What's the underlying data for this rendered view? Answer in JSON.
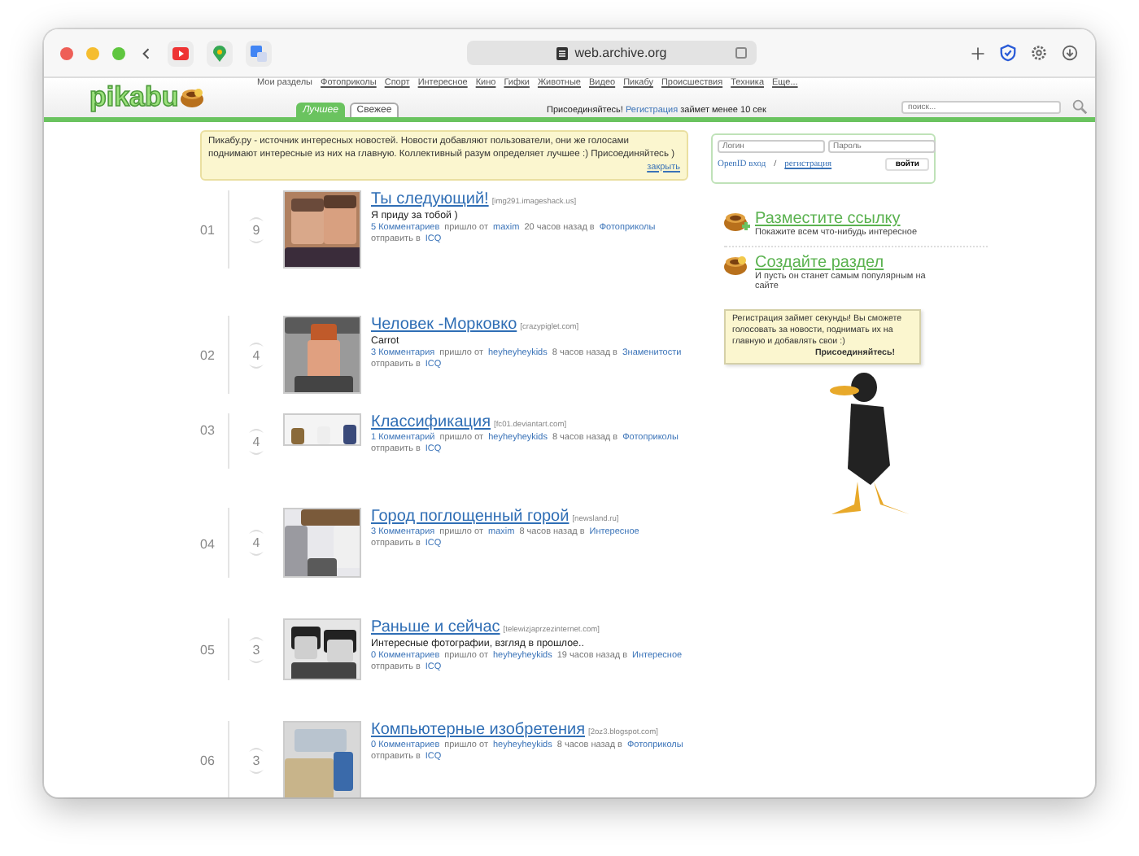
{
  "browser": {
    "url": "web.archive.org"
  },
  "site": {
    "logo": "pikabu",
    "nav": [
      "Мои разделы",
      "Фотоприколы",
      "Спорт",
      "Интересное",
      "Кино",
      "Гифки",
      "Животные",
      "Видео",
      "Пикабу",
      "Происшествия",
      "Техника",
      "Еще..."
    ],
    "tabs": [
      {
        "label": "Лучшее",
        "selected": true
      },
      {
        "label": "Свежее",
        "selected": false
      }
    ],
    "join": {
      "before": "Присоединяйтесь!",
      "link": "Регистрация",
      "after": "займет менее 10 сек"
    },
    "search": {
      "placeholder": "поиск..."
    }
  },
  "info": {
    "text": "Пикабу.ру - источник интересных новостей. Новости добавляют пользователи, они же голосами поднимают интересные из них на главную. Коллективный разум определяет лучшее :) Присоединяйтесь )",
    "close": "закрыть"
  },
  "login": {
    "login_placeholder": "Логин",
    "password_placeholder": "Пароль",
    "openid": "OpenID вход",
    "separator": "/",
    "register": "регистрация",
    "submit": "войти"
  },
  "posts": [
    {
      "rank": "01",
      "votes": "9",
      "title": "Ты следующий!",
      "source": "[img291.imageshack.us]",
      "description": "Я приду за тобой )",
      "comments": "5 Комментариев",
      "from": "пришло от",
      "author": "maxim",
      "time": "20 часов назад в",
      "category": "Фотоприколы",
      "send": "отправить в",
      "icq": "ICQ"
    },
    {
      "rank": "02",
      "votes": "4",
      "title": "Человек -Морковко",
      "source": "[crazypiglet.com]",
      "description": "Carrot",
      "comments": "3 Комментария",
      "from": "пришло от",
      "author": "heyheyheykids",
      "time": "8 часов назад в",
      "category": "Знаменитости",
      "send": "отправить в",
      "icq": "ICQ"
    },
    {
      "rank": "03",
      "votes": "4",
      "title": "Классификация",
      "source": "[fc01.deviantart.com]",
      "comments": "1 Комментарий",
      "from": "пришло от",
      "author": "heyheyheykids",
      "time": "8 часов назад в",
      "category": "Фотоприколы",
      "send": "отправить в",
      "icq": "ICQ"
    },
    {
      "rank": "04",
      "votes": "4",
      "title": "Город поглощенный горой",
      "source": "[newsland.ru]",
      "comments": "3 Комментария",
      "from": "пришло от",
      "author": "maxim",
      "time": "8 часов назад в",
      "category": "Интересное",
      "send": "отправить в",
      "icq": "ICQ"
    },
    {
      "rank": "05",
      "votes": "3",
      "title": "Раньше и сейчас",
      "source": "[telewizjaprzezinternet.com]",
      "description": "Интересные фотографии, взгляд в прошлое..",
      "comments": "0 Комментариев",
      "from": "пришло от",
      "author": "heyheyheykids",
      "time": "19 часов назад в",
      "category": "Интересное",
      "send": "отправить в",
      "icq": "ICQ"
    },
    {
      "rank": "06",
      "votes": "3",
      "title": "Компьютерные изобретения",
      "source": "[2oz3.blogspot.com]",
      "comments": "0 Комментариев",
      "from": "пришло от",
      "author": "heyheyheykids",
      "time": "8 часов назад в",
      "category": "Фотоприколы",
      "send": "отправить в",
      "icq": "ICQ"
    }
  ],
  "sidebar": {
    "actions": [
      {
        "title": "Разместите ссылку",
        "subtitle": "Покажите всем что-нибудь интересное"
      },
      {
        "title": "Создайте раздел",
        "subtitle": "И пусть он станет самым популярным на сайте"
      }
    ],
    "bubble": {
      "text": "Регистрация займет секунды! Вы сможете голосовать за новости, поднимать их на главную и добавлять свои :)",
      "cta": "Присоединяйтесь!"
    }
  }
}
